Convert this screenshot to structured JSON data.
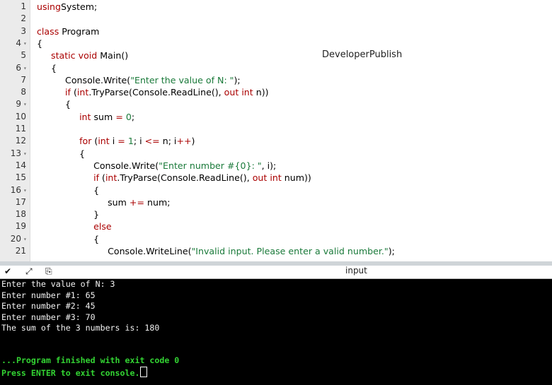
{
  "watermark": "DeveloperPublish",
  "code_lines": [
    {
      "num": "1",
      "fold": "",
      "parts": [
        [
          "kw",
          "using"
        ],
        [
          "",
          "System;"
        ]
      ]
    },
    {
      "num": "2",
      "fold": "",
      "parts": []
    },
    {
      "num": "3",
      "fold": "",
      "parts": [
        [
          "kw",
          "class"
        ],
        [
          "",
          " Program"
        ]
      ]
    },
    {
      "num": "4",
      "fold": "▾",
      "parts": [
        [
          "",
          "{"
        ]
      ]
    },
    {
      "num": "5",
      "fold": "",
      "parts": [
        [
          "",
          "     "
        ],
        [
          "kw",
          "static"
        ],
        [
          "",
          " "
        ],
        [
          "ty",
          "void"
        ],
        [
          "",
          " Main()"
        ]
      ]
    },
    {
      "num": "6",
      "fold": "▾",
      "parts": [
        [
          "",
          "     {"
        ]
      ]
    },
    {
      "num": "7",
      "fold": "",
      "parts": [
        [
          "",
          "          Console.Write("
        ],
        [
          "st",
          "\"Enter the value of N: \""
        ],
        [
          "",
          ");"
        ]
      ]
    },
    {
      "num": "8",
      "fold": "",
      "parts": [
        [
          "",
          "          "
        ],
        [
          "kw",
          "if"
        ],
        [
          "",
          " ("
        ],
        [
          "ty",
          "int"
        ],
        [
          "",
          ".TryParse(Console.ReadLine(), "
        ],
        [
          "kw",
          "out"
        ],
        [
          "",
          " "
        ],
        [
          "ty",
          "int"
        ],
        [
          "",
          " n))"
        ]
      ]
    },
    {
      "num": "9",
      "fold": "▾",
      "parts": [
        [
          "",
          "          {"
        ]
      ]
    },
    {
      "num": "10",
      "fold": "",
      "parts": [
        [
          "",
          "               "
        ],
        [
          "ty",
          "int"
        ],
        [
          "",
          " sum "
        ],
        [
          "op",
          "="
        ],
        [
          "",
          " "
        ],
        [
          "nm",
          "0"
        ],
        [
          "",
          ";"
        ]
      ]
    },
    {
      "num": "11",
      "fold": "",
      "parts": []
    },
    {
      "num": "12",
      "fold": "",
      "parts": [
        [
          "",
          "               "
        ],
        [
          "kw",
          "for"
        ],
        [
          "",
          " ("
        ],
        [
          "ty",
          "int"
        ],
        [
          "",
          " i "
        ],
        [
          "op",
          "="
        ],
        [
          "",
          " "
        ],
        [
          "nm",
          "1"
        ],
        [
          "",
          "; i "
        ],
        [
          "op",
          "<="
        ],
        [
          "",
          " n; i"
        ],
        [
          "op",
          "++"
        ],
        [
          "",
          ")"
        ]
      ]
    },
    {
      "num": "13",
      "fold": "▾",
      "parts": [
        [
          "",
          "               {"
        ]
      ]
    },
    {
      "num": "14",
      "fold": "",
      "parts": [
        [
          "",
          "                    Console.Write("
        ],
        [
          "st",
          "\"Enter number #{0}: \""
        ],
        [
          "",
          ", i);"
        ]
      ]
    },
    {
      "num": "15",
      "fold": "",
      "parts": [
        [
          "",
          "                    "
        ],
        [
          "kw",
          "if"
        ],
        [
          "",
          " ("
        ],
        [
          "ty",
          "int"
        ],
        [
          "",
          ".TryParse(Console.ReadLine(), "
        ],
        [
          "kw",
          "out"
        ],
        [
          "",
          " "
        ],
        [
          "ty",
          "int"
        ],
        [
          "",
          " num))"
        ]
      ]
    },
    {
      "num": "16",
      "fold": "▾",
      "parts": [
        [
          "",
          "                    {"
        ]
      ]
    },
    {
      "num": "17",
      "fold": "",
      "parts": [
        [
          "",
          "                         sum "
        ],
        [
          "op",
          "+="
        ],
        [
          "",
          " num;"
        ]
      ]
    },
    {
      "num": "18",
      "fold": "",
      "parts": [
        [
          "",
          "                    }"
        ]
      ]
    },
    {
      "num": "19",
      "fold": "",
      "parts": [
        [
          "",
          "                    "
        ],
        [
          "kw",
          "else"
        ]
      ]
    },
    {
      "num": "20",
      "fold": "▾",
      "parts": [
        [
          "",
          "                    {"
        ]
      ]
    },
    {
      "num": "21",
      "fold": "",
      "parts": [
        [
          "",
          "                         Console.WriteLine("
        ],
        [
          "st",
          "\"Invalid input. Please enter a valid number.\""
        ],
        [
          "",
          ");"
        ]
      ]
    }
  ],
  "toolbar": {
    "collapse_icon": "✔",
    "expand_icon": "⤢",
    "copy_icon": "⎘",
    "input_label": "input"
  },
  "console": {
    "lines": [
      "Enter the value of N: 3",
      "Enter number #1: 65",
      "Enter number #2: 45",
      "Enter number #3: 70",
      "The sum of the 3 numbers is: 180",
      "",
      "",
      "...Program finished with exit code 0",
      "Press ENTER to exit console."
    ]
  }
}
